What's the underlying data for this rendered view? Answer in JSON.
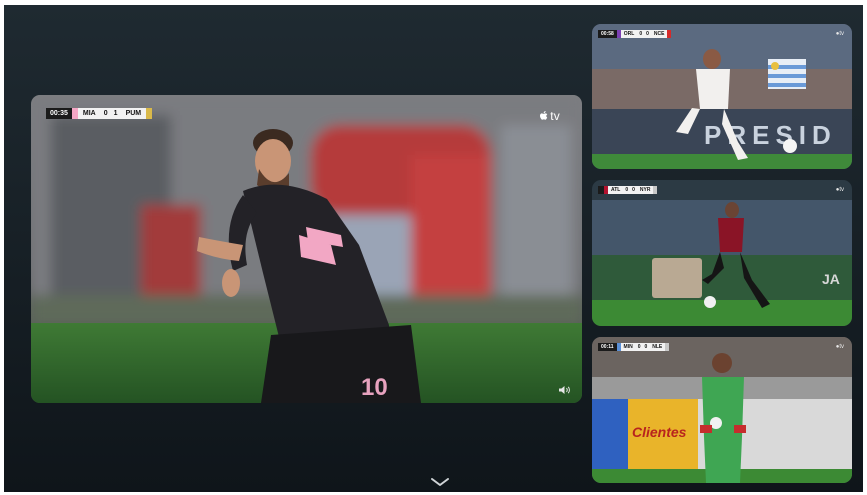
{
  "main_player": {
    "clock": "00:35",
    "home_team": "MIA",
    "home_score": "0",
    "away_score": "1",
    "away_team": "PUM",
    "home_color": "#f4a7c5",
    "away_color": "#d9b94a",
    "broadcaster": "tv",
    "jersey_number": "10",
    "audio_icon": "speaker-icon"
  },
  "side_players": [
    {
      "clock": "00:58",
      "home_team": "ORL",
      "home_score": "0",
      "away_score": "0",
      "away_team": "NCE",
      "home_color": "#7b3fb3",
      "away_color": "#d62a2a",
      "board_text": "PRESID",
      "broadcaster": "tv"
    },
    {
      "clock": "",
      "home_team": "ATL",
      "home_score": "0",
      "away_score": "0",
      "away_team": "NYR",
      "home_color": "#b3122f",
      "away_color": "#c8c8c8",
      "board_text": "JA",
      "broadcaster": "tv"
    },
    {
      "clock": "00:11",
      "home_team": "MIN",
      "home_score": "0",
      "away_score": "0",
      "away_team": "NLE",
      "home_color": "#5a8fd6",
      "away_color": "#c8c8c8",
      "board_text": "Clientes",
      "broadcaster": "tv"
    }
  ],
  "nav": {
    "expand_icon": "chevron-down-icon"
  }
}
